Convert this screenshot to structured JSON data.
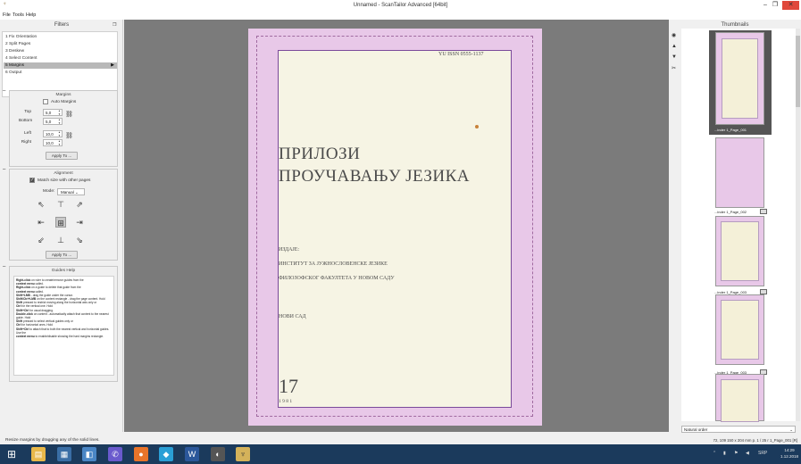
{
  "window": {
    "title": "Unnamed - ScanTailor Advanced [64bit]",
    "min_glyph": "–",
    "max_glyph": "❐",
    "close_glyph": "✕"
  },
  "menu": {
    "file": "File",
    "tools": "Tools",
    "help": "Help"
  },
  "filters": {
    "title": "Filters",
    "items": [
      {
        "label": "1  Fix Orientation"
      },
      {
        "label": "2  Split Pages"
      },
      {
        "label": "3  Deskew"
      },
      {
        "label": "4  Select Content"
      },
      {
        "label": "5  Margins",
        "selected": true
      },
      {
        "label": "6  Output"
      }
    ]
  },
  "margins": {
    "title": "Margins",
    "auto_label": "Auto Margins",
    "top_label": "Top",
    "top_value": "5,0",
    "bottom_label": "Bottom",
    "bottom_value": "5,0",
    "left_label": "Left",
    "left_value": "10,0",
    "right_label": "Right",
    "right_value": "10,0",
    "apply_label": "Apply To ..."
  },
  "alignment": {
    "title": "Alignment",
    "match_label": "Match size with other pages",
    "mode_label": "Mode:",
    "mode_value": "Manual",
    "apply_label": "Apply To ..."
  },
  "guides": {
    "title": "Guides Help",
    "lines": [
      {
        "b": "Right-click",
        "t": " on ruler to create/remove guides from the "
      },
      {
        "b": "context menu",
        "t": " called."
      },
      {
        "b": "Right-click",
        "t": " on a guide to delete that guide from the "
      },
      {
        "b": "context menu",
        "t": " called."
      },
      {
        "b": "Shift+LMB",
        "t": " - drag the guide under the cursor."
      },
      {
        "b": "Shift/Ctrl+LMB",
        "t": " on the content rectangle - drag the page content. Hold "
      },
      {
        "b": "Shift",
        "t": " pressed to restrict moving along the horizontal axis only or "
      },
      {
        "b": "Ctrl",
        "t": " for the vertical one. Hold "
      },
      {
        "b": "Shift+Ctrl",
        "t": " for usual dragging."
      },
      {
        "b": "Double-click",
        "t": " on content - automatically attach that content to the nearest guide. Hold "
      },
      {
        "b": "Shift",
        "t": " pressed to select vertical guides only or "
      },
      {
        "b": "Ctrl",
        "t": " for horizontal ones. Hold "
      },
      {
        "b": "Shift+Ctrl",
        "t": " to attach that to both the nearest vertical and horizontal guides."
      },
      {
        "b": "",
        "t": "Use the "
      },
      {
        "b": "context menu",
        "t": " to enable/disable showing the hard margins rectangle."
      }
    ]
  },
  "document": {
    "issn": "YU ISSN 0555-1137",
    "title_line1": "ПРИЛОЗИ",
    "title_line2": "ПРОУЧАВАЊУ ЈЕЗИКА",
    "publisher_label": "ИЗДАЈЕ:",
    "publisher_line1": "ИНСТИТУТ ЗА ЈУЖНОСЛОВЕНСКЕ ЈЕЗИКЕ",
    "publisher_line2": "ФИЛОЗОФСКОГ ФАКУЛТЕТА У НОВОМ САДУ",
    "city": "НОВИ САД",
    "volume": "17",
    "year": "1 9 8 1"
  },
  "thumbnails": {
    "title": "Thumbnails",
    "items": [
      {
        "label": "...inder 1_Page_001",
        "selected": true
      },
      {
        "label": "...inder 1_Page_002"
      },
      {
        "label": "...inder 1_Page_003"
      },
      {
        "label": "...inder 1_Page_003"
      }
    ],
    "sort": "Natural order"
  },
  "status": {
    "left": "Resize margins by dragging any of the solid lines.",
    "right": "72, 109    150 x 204 mm    p. 1 / 25    r 1_Page_001 [R]"
  },
  "taskbar": {
    "lang": "SRP",
    "time": "14:29",
    "date": "1.12.2018"
  },
  "colors": {
    "accent_close": "#e0483b",
    "page_margin": "#e8c8e8",
    "content_border": "#7a4a9a",
    "paper": "#f6f4e4",
    "taskbar": "#1b3a5c"
  }
}
